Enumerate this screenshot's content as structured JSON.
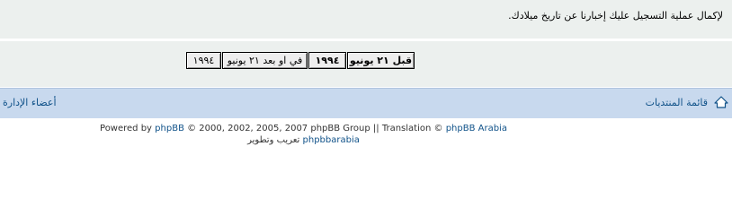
{
  "notice": {
    "text": "لإكمال عملية التسجيل عليك إخبارنا عن تاريخ ميلادك."
  },
  "age_options": [
    {
      "label": "قبل ٢١ يونيو",
      "bold": true
    },
    {
      "label": "١٩٩٤",
      "bold": true
    },
    {
      "label": "في او بعد ٢١ يونيو",
      "bold": false
    },
    {
      "label": "١٩٩٤",
      "bold": false
    }
  ],
  "navbar": {
    "index_link": "قائمة المنتديات",
    "team_link": "أعضاء الإدارة"
  },
  "footer": {
    "powered_by": "Powered by",
    "phpbb": "phpBB",
    "copyright": "© 2000, 2002, 2005, 2007 phpBB Group || Translation ©",
    "arabia": "phpBB Arabia",
    "translator": "phpbbarabia",
    "translator_suffix": "تعريب وتطوير"
  },
  "colors": {
    "panel": "#ecf0ee",
    "navbar": "#c8d9ee",
    "link": "#105289"
  },
  "icons": {
    "home": "home-icon"
  }
}
